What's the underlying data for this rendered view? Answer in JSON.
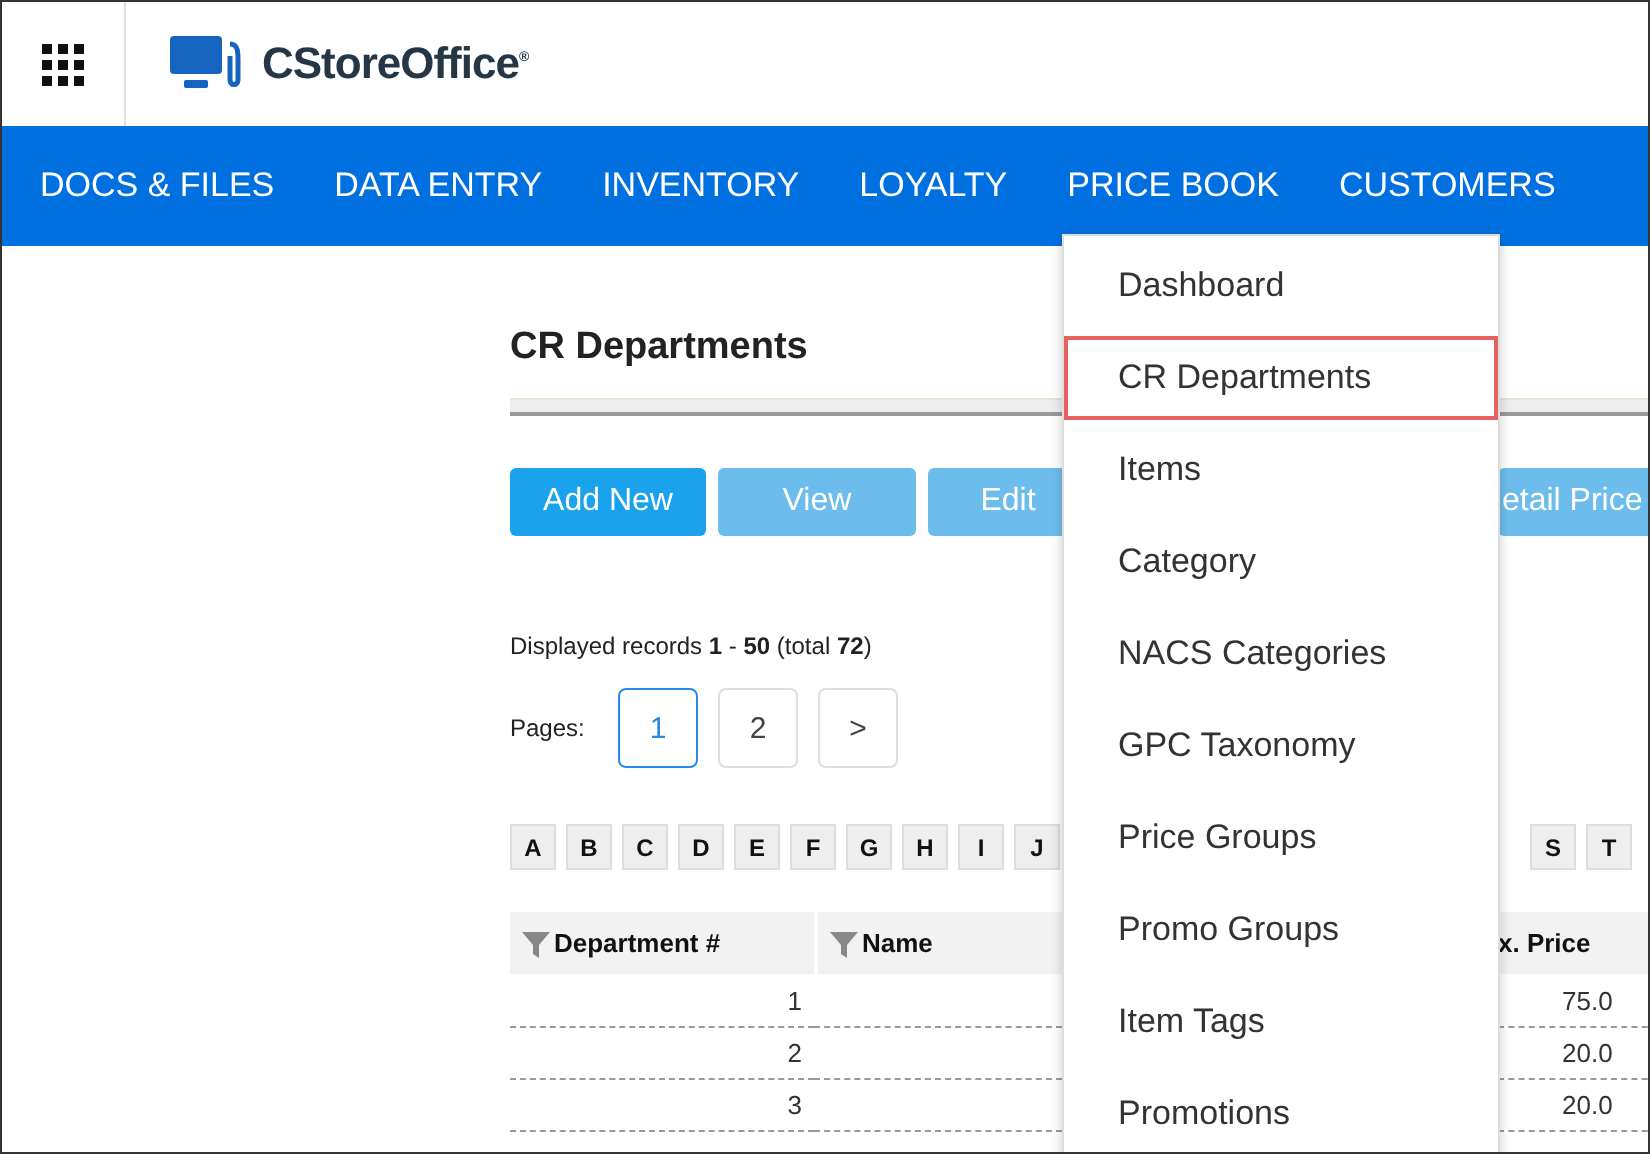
{
  "app": {
    "name": "CStoreOffice",
    "mark": "®"
  },
  "nav": [
    "DOCS & FILES",
    "DATA ENTRY",
    "INVENTORY",
    "LOYALTY",
    "PRICE BOOK",
    "CUSTOMERS"
  ],
  "page": {
    "title": "CR Departments",
    "buttons": [
      {
        "label": "Add New",
        "disabled": false
      },
      {
        "label": "View",
        "disabled": true
      },
      {
        "label": "Edit",
        "disabled": true
      }
    ],
    "buttons_right_of_menu": [
      {
        "label": "etail Price",
        "disabled": true
      }
    ],
    "records": "Displayed records **1** - **50** (total **72**)",
    "pages_label": "Pages:",
    "pages": [
      {
        "label": "1",
        "selected": true
      },
      {
        "label": "2",
        "selected": false
      },
      {
        "label": ">",
        "selected": false
      }
    ],
    "letters": [
      "A",
      "B",
      "C",
      "D",
      "E",
      "F",
      "G",
      "H",
      "I",
      "J"
    ],
    "letters_right_of_menu": [
      "S",
      "T"
    ],
    "table": {
      "columns": [
        {
          "label": "Department #",
          "filter": true
        },
        {
          "label": "Name",
          "filter": true
        }
      ],
      "columns_right_of_menu": [
        {
          "label": "x. Price",
          "filter": false
        }
      ],
      "rows": [
        {
          "department": "1",
          "price": "75.0"
        },
        {
          "department": "2",
          "price": "20.0"
        },
        {
          "department": "3",
          "price": "20.0"
        }
      ]
    }
  },
  "menu": [
    {
      "label": "Dashboard",
      "selected": false
    },
    {
      "label": "CR Departments",
      "selected": true
    },
    {
      "label": "Items",
      "selected": false
    },
    {
      "label": "Category",
      "selected": false
    },
    {
      "label": "NACS Categories",
      "selected": false
    },
    {
      "label": "GPC Taxonomy",
      "selected": false
    },
    {
      "label": "Price Groups",
      "selected": false
    },
    {
      "label": "Promo Groups",
      "selected": false
    },
    {
      "label": "Item Tags",
      "selected": false
    },
    {
      "label": "Promotions",
      "selected": false
    }
  ]
}
